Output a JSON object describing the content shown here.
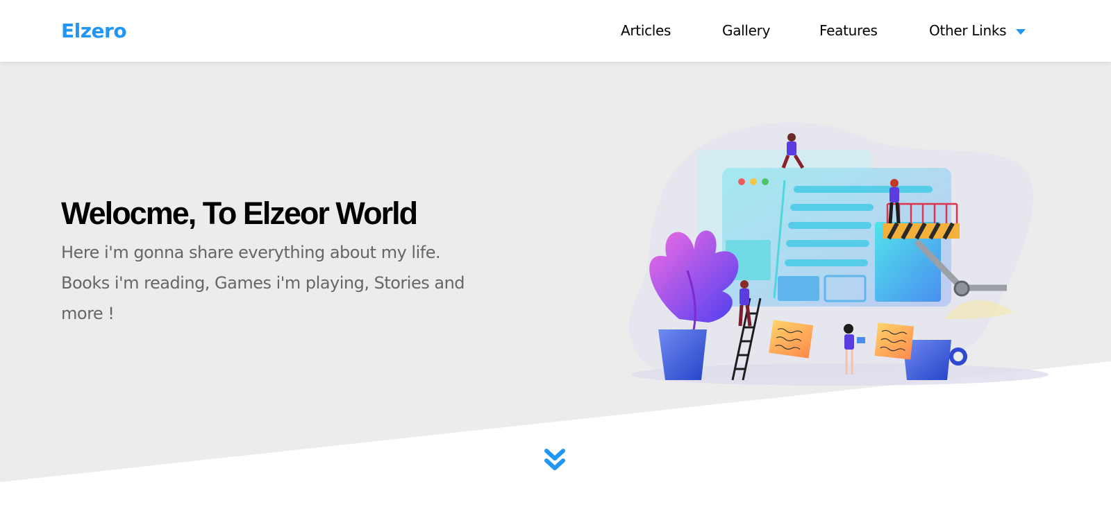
{
  "header": {
    "logo": "Elzero",
    "nav": [
      "Articles",
      "Gallery",
      "Features",
      "Other Links"
    ]
  },
  "hero": {
    "title": "Welocme, To Elzeor World",
    "text": "Here i'm gonna share everything about my life. Books i'm reading, Games i'm playing, Stories and more !"
  },
  "icons": {
    "dropdown": "caret-down-icon",
    "scroll": "chevrons-down-icon"
  },
  "colors": {
    "accent": "#2196f3",
    "landing_bg": "#ececec",
    "text_muted": "#666666",
    "heading": "#000000"
  }
}
